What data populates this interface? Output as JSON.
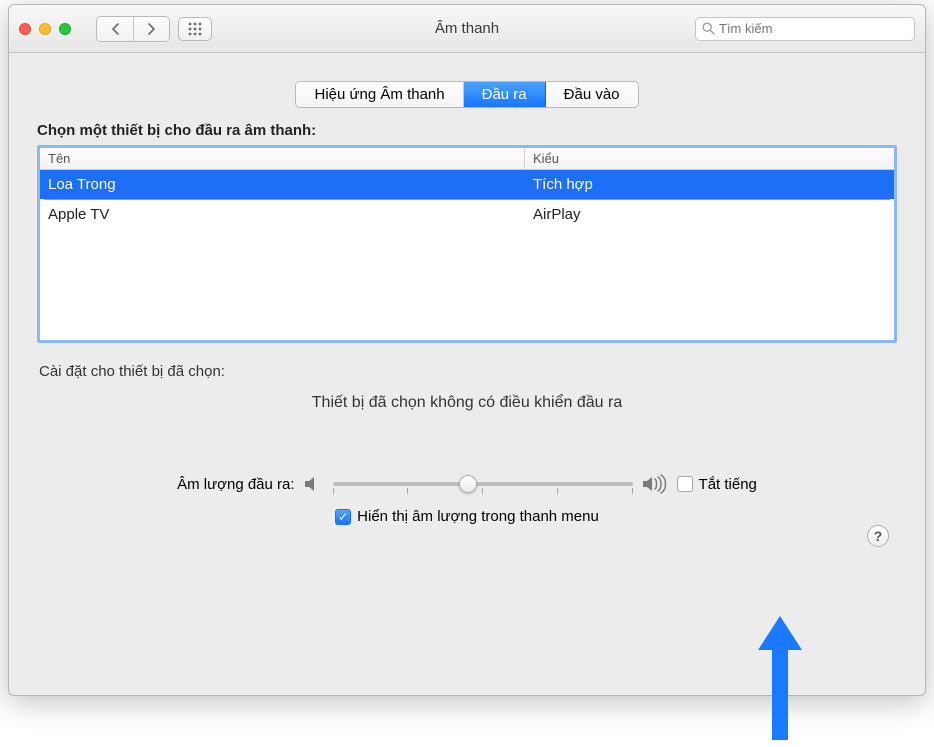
{
  "window": {
    "title": "Âm thanh",
    "search_placeholder": "Tìm kiếm"
  },
  "tabs": [
    {
      "label": "Hiệu ứng Âm thanh",
      "active": false
    },
    {
      "label": "Đầu ra",
      "active": true
    },
    {
      "label": "Đầu vào",
      "active": false
    }
  ],
  "select_device_heading": "Chọn một thiết bị cho đầu ra âm thanh:",
  "columns": {
    "name": "Tên",
    "type": "Kiểu"
  },
  "devices": [
    {
      "name": "Loa Trong",
      "type": "Tích hợp",
      "selected": true
    },
    {
      "name": "Apple TV",
      "type": "AirPlay",
      "selected": false
    }
  ],
  "settings_for_selected": "Cài đặt cho thiết bị đã chọn:",
  "no_controls_text": "Thiết bị đã chọn không có điều khiển đầu ra",
  "output_volume_label": "Âm lượng đầu ra:",
  "mute_label": "Tắt tiếng",
  "show_volume_label": "Hiển thị âm lượng trong thanh menu",
  "volume": {
    "value": 0.45
  },
  "mute_checked": false,
  "show_volume_checked": true
}
